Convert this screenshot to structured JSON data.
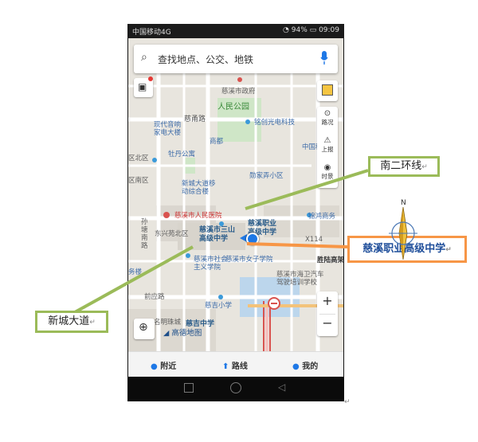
{
  "status_bar": {
    "carrier": "中国移动4G",
    "battery": "94%",
    "time": "09:09"
  },
  "search": {
    "placeholder": "查找地点、公交、地铁"
  },
  "map_labels": {
    "government": "慈溪市政府",
    "park": "人民公园",
    "street_cinan": "慈甬路",
    "optoelectronics": "铭创光电科技",
    "furniture_1": "现代音响",
    "furniture_2": "家电大楼",
    "commercial": "商都",
    "china_mobile": "中国移",
    "ne_district": "区北区",
    "mudan": "牡丹公寓",
    "xincheng_1": "新城大道移",
    "xincheng_2": "动综合楼",
    "zhangjia": "勋家弄小区",
    "south_district": "区南区",
    "hospital": "慈溪市人民医院",
    "vocational_1": "慈溪职业",
    "vocational_2": "高级中学",
    "jinhong": "锦鸿商务",
    "sun_1": "孙",
    "sun_2": "塘",
    "sun_3": "南",
    "sun_4": "路",
    "dongxing": "东兴苑北区",
    "sanshan_1": "慈溪市三山",
    "sanshan_2": "高级中学",
    "x114": "X114",
    "shehui_1": "慈溪市社会",
    "shehui_2": "主义学院",
    "women_school": "慈溪市女子学院",
    "shengsheng": "胜陆高架",
    "yaoshi": "务楼",
    "haiwei_1": "慈溪市海卫汽车",
    "haiwei_2": "驾驶培训学校",
    "qiantu": "前应路",
    "ciji_primary": "慈吉小学",
    "ming_city": "名明珠城",
    "ciji_middle": "慈吉中学",
    "amap": "高德地图"
  },
  "controls": {
    "road_status": "路况",
    "report": "上报",
    "timelapse": "时景",
    "zoom_in": "+",
    "zoom_out": "−"
  },
  "bottom_nav": {
    "nearby": "附近",
    "route": "路线",
    "mine": "我的"
  },
  "callouts": {
    "ring_road": "南二环线",
    "xincheng_road": "新城大道",
    "school": "慈溪职业高级中学"
  },
  "compass": {
    "north": "N"
  },
  "colors": {
    "callout_green": "#9bbb59",
    "callout_orange": "#f79646",
    "location_blue": "#1e78e6"
  }
}
